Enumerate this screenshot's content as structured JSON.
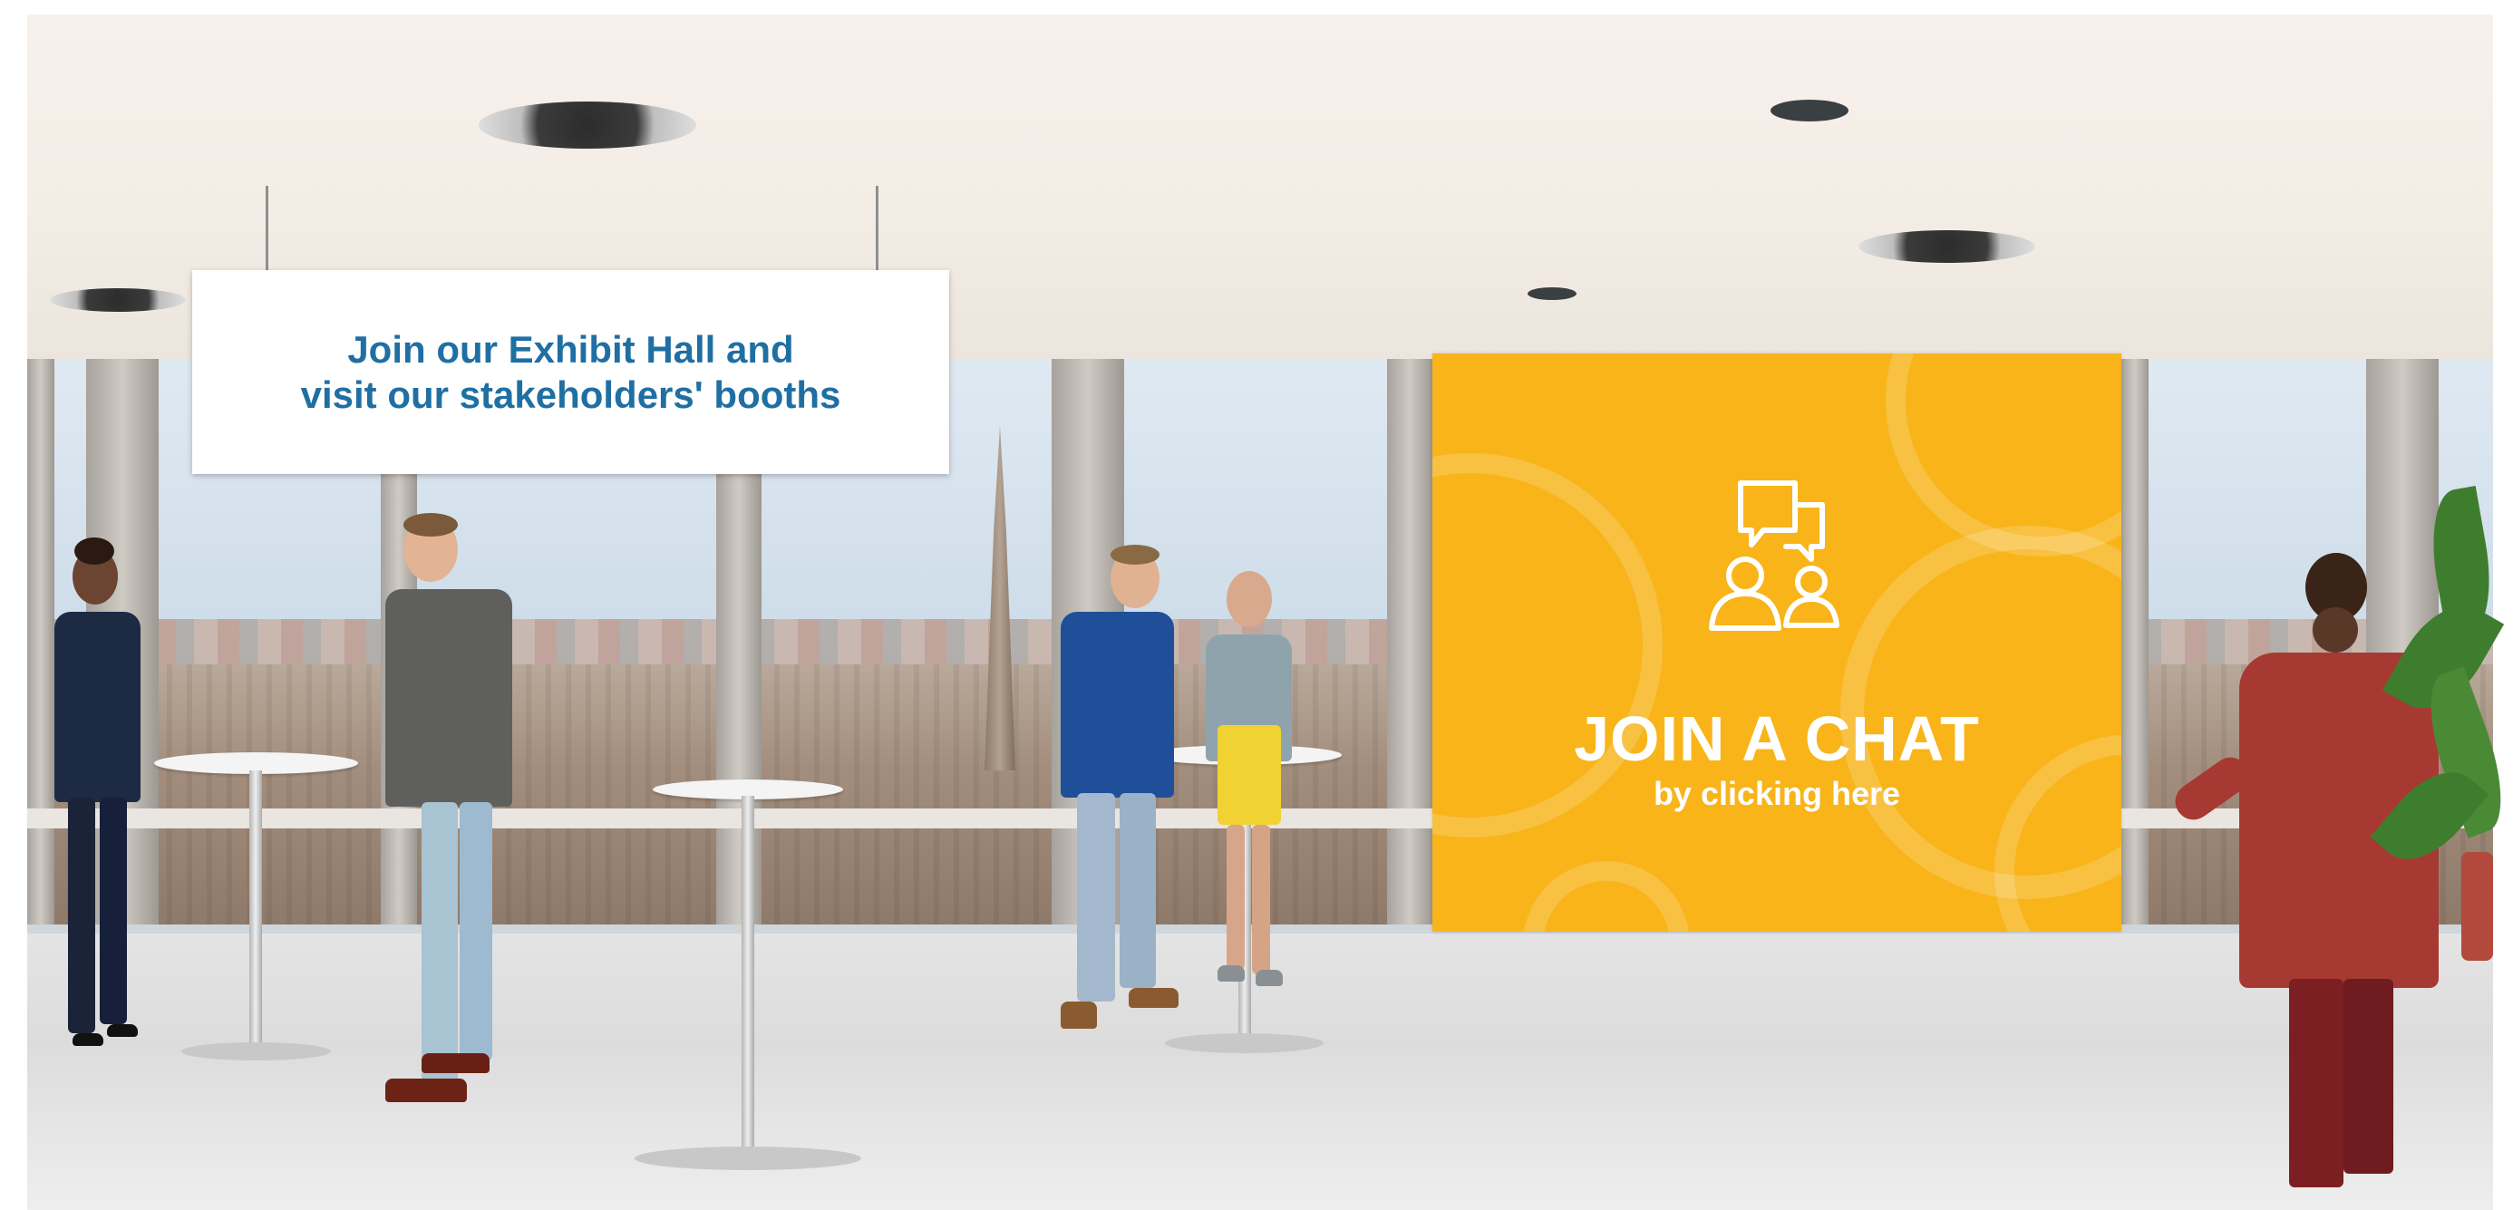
{
  "exhibit_sign": {
    "line1": "Join our Exhibit Hall and",
    "line2": "visit our stakeholders' booths",
    "text_color": "#1f6fa3"
  },
  "chat_board": {
    "title": "JOIN A CHAT",
    "subtitle": "by clicking here",
    "background_color": "#f8b419",
    "icon": "chat-people-icon"
  }
}
